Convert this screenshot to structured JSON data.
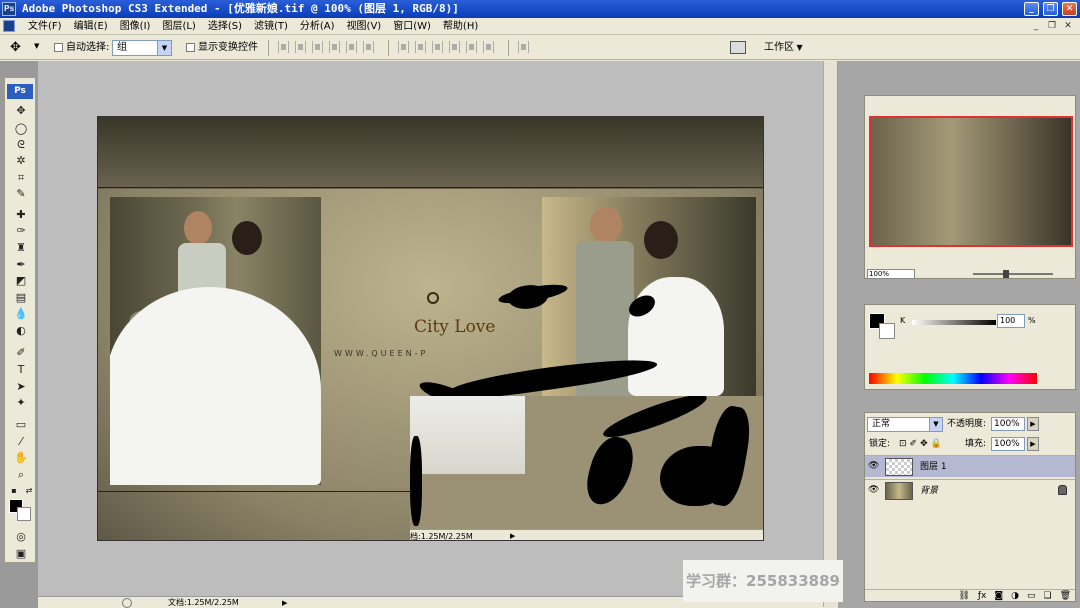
{
  "window": {
    "title": "Adobe Photoshop CS3 Extended - [优雅新娘.tif @ 100% (图层 1, RGB/8)]",
    "app_badge": "Ps"
  },
  "menu": [
    "文件(F)",
    "编辑(E)",
    "图像(I)",
    "图层(L)",
    "选择(S)",
    "滤镜(T)",
    "分析(A)",
    "视图(V)",
    "窗口(W)",
    "帮助(H)"
  ],
  "options": {
    "auto_select_label": "自动选择:",
    "auto_select_value": "组",
    "show_transform_label": "显示变换控件",
    "workspace_label": "工作区"
  },
  "canvas": {
    "logo_text": "City Love",
    "logo_url": "WWW.QUEEN-P",
    "sub_status": "档:1.25M/2.25M"
  },
  "doc_status": "文档:1.25M/2.25M",
  "navigator": {
    "zoom": "100%"
  },
  "color": {
    "channel_label": "K",
    "value": "100",
    "unit": "%"
  },
  "layers": {
    "blend_mode": "正常",
    "opacity_label": "不透明度:",
    "opacity": "100%",
    "lock_label": "锁定:",
    "fill_label": "填充:",
    "fill": "100%",
    "items": [
      {
        "name": "图层 1",
        "selected": true
      },
      {
        "name": "背景",
        "selected": false,
        "locked": true
      }
    ]
  },
  "watermark": "学习群：255833889"
}
